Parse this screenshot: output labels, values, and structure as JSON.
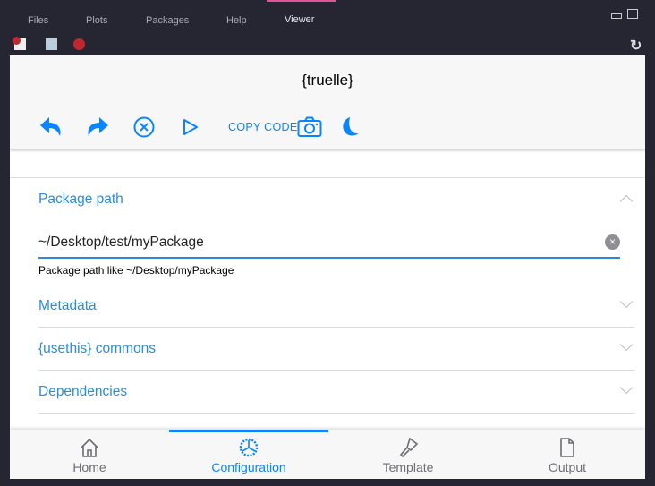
{
  "ide_tabs": [
    {
      "label": "Files"
    },
    {
      "label": "Plots"
    },
    {
      "label": "Packages"
    },
    {
      "label": "Help"
    },
    {
      "label": "Viewer",
      "active": true
    }
  ],
  "app": {
    "title": "{truelle}",
    "copy_code": "COPY CODE"
  },
  "sections": [
    {
      "label": "Package path",
      "expanded": true
    },
    {
      "label": "Metadata"
    },
    {
      "label": "{usethis} commons"
    },
    {
      "label": "Dependencies"
    }
  ],
  "package_path": {
    "value": "~/Desktop/test/myPackage",
    "hint": "Package path like ~/Desktop/myPackage"
  },
  "bottom_nav": [
    {
      "label": "Home"
    },
    {
      "label": "Configuration",
      "active": true
    },
    {
      "label": "Template"
    },
    {
      "label": "Output"
    }
  ],
  "colors": {
    "accent": "#0a84ff",
    "section": "#2a8ce0",
    "ide_bg": "#262633",
    "tab_indicator": "#e0559a"
  }
}
